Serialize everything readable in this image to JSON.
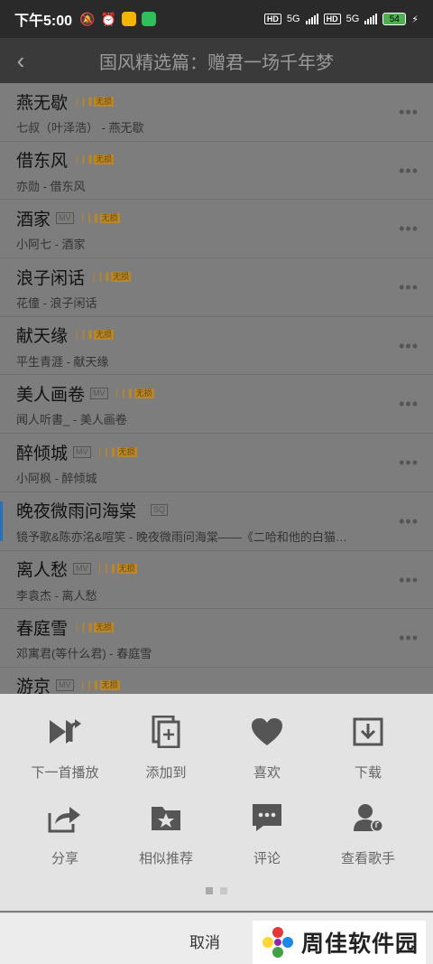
{
  "status": {
    "time": "下午5:00",
    "net1": "5G",
    "net2": "5G",
    "battery": "54",
    "hd": "HD"
  },
  "header": {
    "title": "国风精选篇：赠君一场千年梦"
  },
  "tags": {
    "mv": "MV",
    "sq": "SQ",
    "lossless": "无损"
  },
  "songs": [
    {
      "title": "燕无歇",
      "subtitle": "七叔（叶泽浩） - 燕无歇"
    },
    {
      "title": "借东风",
      "subtitle": "亦勋 - 借东风"
    },
    {
      "title": "酒家",
      "subtitle": "小阿七 - 酒家"
    },
    {
      "title": "浪子闲话",
      "subtitle": "花僮 - 浪子闲话"
    },
    {
      "title": "献天缘",
      "subtitle": "平生青涯 - 献天缘"
    },
    {
      "title": "美人画卷",
      "subtitle": "闻人听書_ - 美人画卷"
    },
    {
      "title": "醉倾城",
      "subtitle": "小阿枫 - 醉倾城"
    },
    {
      "title": "晚夜微雨问海棠",
      "subtitle": "镜予歌&陈亦洺&喧笑 - 晚夜微雨问海棠——《二哈和他的白猫…"
    },
    {
      "title": "离人愁",
      "subtitle": "李袁杰 - 离人愁"
    },
    {
      "title": "春庭雪",
      "subtitle": "邓寓君(等什么君) - 春庭雪"
    },
    {
      "title": "游京",
      "subtitle": ""
    }
  ],
  "actions": [
    {
      "label": "下一首播放",
      "icon": "play-next-icon"
    },
    {
      "label": "添加到",
      "icon": "add-to-icon"
    },
    {
      "label": "喜欢",
      "icon": "heart-icon"
    },
    {
      "label": "下载",
      "icon": "download-icon"
    },
    {
      "label": "分享",
      "icon": "share-icon"
    },
    {
      "label": "相似推荐",
      "icon": "similar-folder-icon"
    },
    {
      "label": "评论",
      "icon": "comment-icon"
    },
    {
      "label": "查看歌手",
      "icon": "artist-icon"
    }
  ],
  "cancel_label": "取消",
  "watermark": {
    "text": "周佳软件园"
  },
  "colors": {
    "sheet_bg": "#e3e3e3",
    "overlay": "#7d7d7d",
    "lossless_gold": "#b8872a",
    "icon_gray": "#555555"
  }
}
